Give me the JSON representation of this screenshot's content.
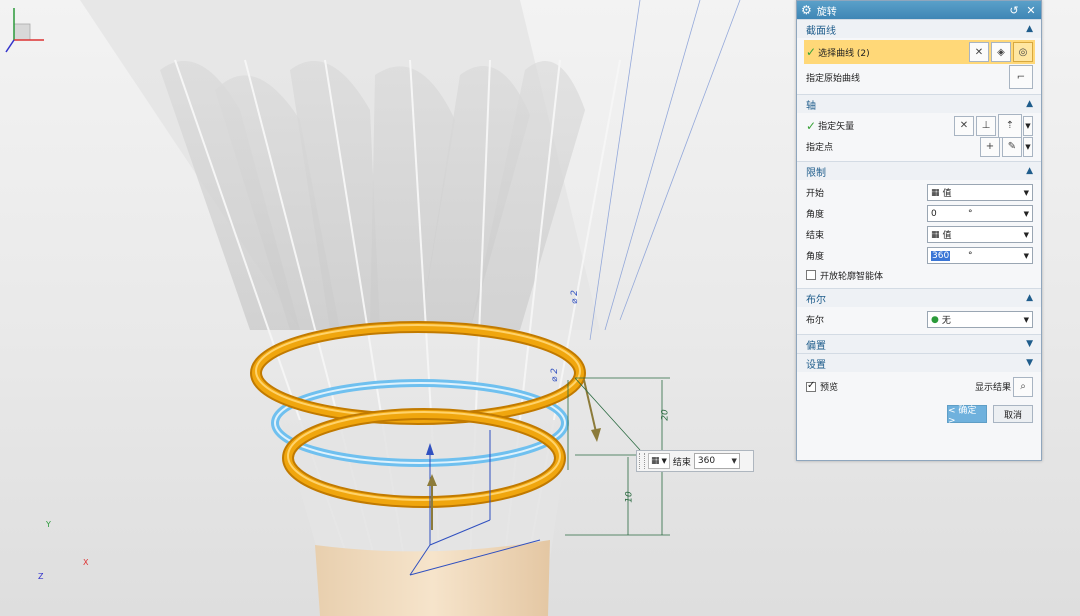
{
  "dialog": {
    "title": "旋转",
    "icons": [
      "gear-icon",
      "reset-icon",
      "close-icon"
    ],
    "sections": {
      "section_curve": {
        "header": "截面线",
        "select_curve": "选择曲线 (2)",
        "specify_origin_curve": "指定原始曲线"
      },
      "axis": {
        "header": "轴",
        "specify_vector": "指定矢量",
        "specify_point": "指定点"
      },
      "limits": {
        "header": "限制",
        "start_label": "开始",
        "start_mode": "值",
        "start_angle_label": "角度",
        "start_angle": "0",
        "end_label": "结束",
        "end_mode": "值",
        "end_angle_label": "角度",
        "end_angle": "360",
        "angle_unit": "°",
        "open_profile": "开放轮廓智能体"
      },
      "boolean": {
        "header": "布尔",
        "label": "布尔",
        "value": "无"
      },
      "offset": {
        "header": "偏置"
      },
      "settings": {
        "header": "设置"
      }
    },
    "preview_label": "预览",
    "show_result": "显示结果",
    "ok": "< 确定 >",
    "cancel": "取消"
  },
  "graphics": {
    "dim_top_diameter": "⌀ 2",
    "dim_mid_diameter": "⌀ 2",
    "dim_upper": "20",
    "dim_lower": "10",
    "floating_label": "结束",
    "floating_value": "360",
    "triad": {
      "x": "X",
      "y": "Y",
      "z": "Z"
    },
    "colors": {
      "ring": "#f0a60e",
      "ring_edge": "#c17a00",
      "selected_ring": "#6fc0ef",
      "cork": "#f1dcc0",
      "dialog_accent": "#1f5d8c"
    }
  }
}
